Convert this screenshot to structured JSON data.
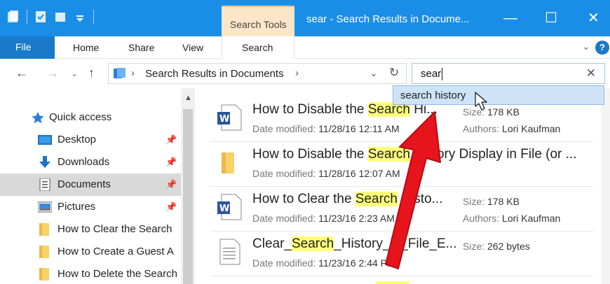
{
  "window": {
    "title": "sear - Search Results in Docume...",
    "context_group": "Search Tools",
    "buttons": {
      "minimize": "—",
      "maximize": "☐",
      "close": "✕"
    }
  },
  "ribbon": {
    "tabs": [
      "File",
      "Home",
      "Share",
      "View",
      "Search"
    ],
    "help": "?",
    "collapse": "⌄"
  },
  "address": {
    "crumb": "Search Results in Documents",
    "sep": "›",
    "sep2": "›"
  },
  "search": {
    "value": "sear",
    "clear": "✕",
    "suggestion": "search history"
  },
  "nav": {
    "items": [
      {
        "label": "Quick access",
        "icon": "star-icon"
      },
      {
        "label": "Desktop",
        "icon": "desktop-icon",
        "pinned": true
      },
      {
        "label": "Downloads",
        "icon": "download-icon",
        "pinned": true
      },
      {
        "label": "Documents",
        "icon": "documents-icon",
        "pinned": true,
        "selected": true
      },
      {
        "label": "Pictures",
        "icon": "pictures-icon",
        "pinned": true
      },
      {
        "label": "How to Clear the Search",
        "icon": "folder-icon"
      },
      {
        "label": "How to Create a Guest A",
        "icon": "folder-icon"
      },
      {
        "label": "How to Delete the Search",
        "icon": "folder-icon"
      }
    ]
  },
  "results": [
    {
      "pre": "How to Disable the ",
      "hl": "Search",
      "post": " Hi...",
      "date_label": "Date modified:",
      "date": "11/28/16 12:11 AM",
      "size_label": "Size:",
      "size": "178 KB",
      "authors_label": "Authors:",
      "authors": "Lori Kaufman",
      "type": "word"
    },
    {
      "pre": "How to Disable the ",
      "hl": "Search",
      "post": " History Display in File (or ...",
      "date_label": "Date modified:",
      "date": "11/28/16 12:07 AM",
      "type": "folder"
    },
    {
      "pre": "How to Clear the ",
      "hl": "Search",
      "post": " Histo...",
      "date_label": "Date modified:",
      "date": "11/23/16 2:23 AM",
      "size_label": "Size:",
      "size": "178 KB",
      "authors_label": "Authors:",
      "authors": "Lori Kaufman",
      "type": "word"
    },
    {
      "pre": "Clear_",
      "hl": "Search",
      "post": "_History_in_File_E...",
      "date_label": "Date modified:",
      "date": "11/23/16 2:44 PM",
      "size_label": "Size:",
      "size": "262 bytes",
      "type": "text"
    }
  ],
  "colors": {
    "titlebar": "#1a8ee6",
    "file_tab": "#1979ca",
    "context_tab": "#fde6c7",
    "highlight": "#ffff7a",
    "arrow": "#e8141c"
  }
}
